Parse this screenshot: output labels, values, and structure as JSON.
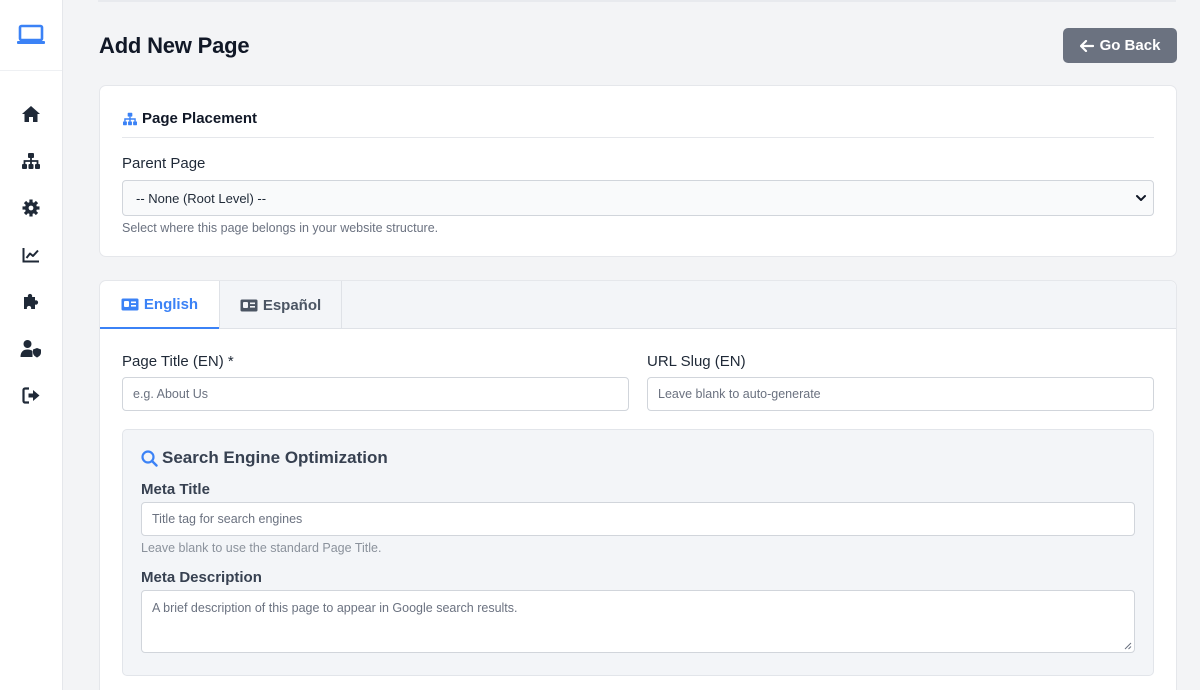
{
  "page": {
    "title": "Add New Page",
    "go_back_label": "Go Back"
  },
  "sidebar": {
    "brand_icon": "laptop-icon",
    "items": [
      {
        "icon": "home-icon"
      },
      {
        "icon": "sitemap-icon"
      },
      {
        "icon": "gear-icon"
      },
      {
        "icon": "chart-line-icon"
      },
      {
        "icon": "puzzle-icon"
      },
      {
        "icon": "user-shield-icon"
      },
      {
        "icon": "logout-icon"
      }
    ]
  },
  "placement": {
    "heading": "Page Placement",
    "parent_label": "Parent Page",
    "parent_selected": "-- None (Root Level) --",
    "help": "Select where this page belongs in your website structure."
  },
  "tabs": [
    {
      "label": "English",
      "active": true
    },
    {
      "label": "Español",
      "active": false
    }
  ],
  "form": {
    "title_label": "Page Title (EN) *",
    "title_placeholder": "e.g. About Us",
    "slug_label": "URL Slug (EN)",
    "slug_placeholder": "Leave blank to auto-generate"
  },
  "seo": {
    "heading": "Search Engine Optimization",
    "meta_title_label": "Meta Title",
    "meta_title_placeholder": "Title tag for search engines",
    "meta_title_help": "Leave blank to use the standard Page Title.",
    "meta_desc_label": "Meta Description",
    "meta_desc_placeholder": "A brief description of this page to appear in Google search results."
  },
  "colors": {
    "accent": "#3b82f6",
    "sidebar_icon": "#1f2937",
    "button": "#6b7280"
  }
}
